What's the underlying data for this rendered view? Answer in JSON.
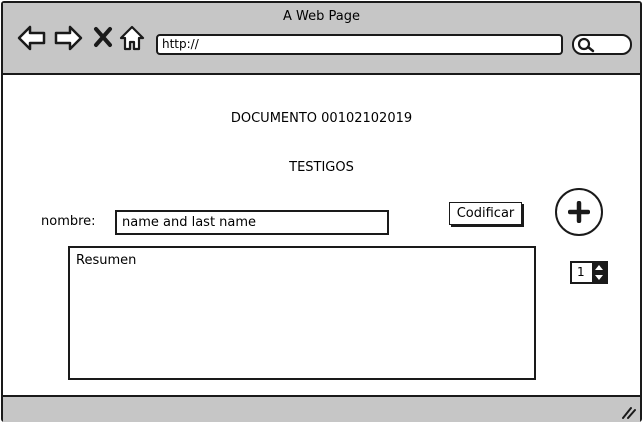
{
  "window": {
    "title": "A Web Page"
  },
  "toolbar": {
    "icons": [
      "back-icon",
      "forward-icon",
      "close-icon",
      "home-icon",
      "search-icon"
    ],
    "url": "http://"
  },
  "main": {
    "document_label": "DOCUMENTO 00102102019",
    "section_title": "TESTIGOS",
    "name_label": "nombre:",
    "name_value": "name and last name",
    "encode_button": "Codificar",
    "summary_text": "Resumen",
    "stepper_value": "1"
  }
}
